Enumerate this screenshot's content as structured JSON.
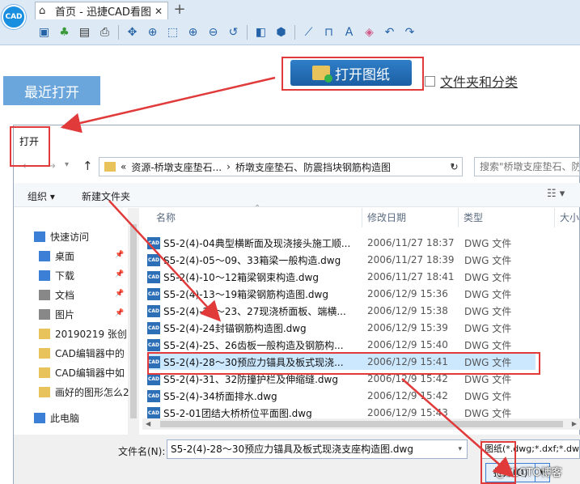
{
  "app": {
    "logo_text": "CAD",
    "tab_title": "首页 - 迅捷CAD看图",
    "tab_close": "✕",
    "new_tab": "+"
  },
  "toolbar": {
    "icons": [
      "add-file-icon",
      "palm-tree-icon",
      "save-icon",
      "print-icon",
      "pan-icon",
      "zoom-window-icon",
      "zoom-extents-icon",
      "zoom-in-icon",
      "zoom-out-icon",
      "zoom-previous-icon",
      "3d-box-icon",
      "3d-view-icon",
      "measure-line-icon",
      "measure-area-icon",
      "text-icon",
      "eraser-icon",
      "undo-icon",
      "redo-icon"
    ]
  },
  "home": {
    "recent_label": "最近打开",
    "open_button": "打开图纸",
    "folder_checkbox_label": "文件夹和分类"
  },
  "dialog": {
    "title": "打开",
    "address": {
      "prefix": "«",
      "crumb1": "资源-桥墩支座垫石...",
      "sep": "›",
      "crumb2": "桥墩支座垫石、防震挡块钢筋构造图"
    },
    "search_placeholder": "搜索\"桥墩支座垫石、防",
    "organize": "组织 ▾",
    "new_folder": "新建文件夹",
    "nav": [
      {
        "label": "快速访问",
        "icon": "star-icon"
      },
      {
        "label": "桌面",
        "icon": "desktop-icon"
      },
      {
        "label": "下载",
        "icon": "download-icon"
      },
      {
        "label": "文档",
        "icon": "document-icon"
      },
      {
        "label": "图片",
        "icon": "picture-icon"
      },
      {
        "label": "20190219  张创",
        "icon": "folder-icon"
      },
      {
        "label": "CAD编辑器中的",
        "icon": "folder-icon"
      },
      {
        "label": "CAD编辑器中如",
        "icon": "folder-icon"
      },
      {
        "label": "画好的图形怎么2",
        "icon": "folder-icon"
      },
      {
        "label": "此电脑",
        "icon": "computer-icon"
      }
    ],
    "columns": {
      "name": "名称",
      "date": "修改日期",
      "type": "类型",
      "size": "大小"
    },
    "files": [
      {
        "name": "S5-2(4)-04典型横断面及现浇接头施工顺...",
        "date": "2006/11/27 18:37",
        "type": "DWG 文件"
      },
      {
        "name": "S5-2(4)-05～09、33箱梁一般构造.dwg",
        "date": "2006/11/27 18:39",
        "type": "DWG 文件"
      },
      {
        "name": "S5-2(4)-10～12箱梁钢束构造.dwg",
        "date": "2006/11/27 18:41",
        "type": "DWG 文件"
      },
      {
        "name": "S5-2(4)-13～19箱梁钢筋构造图.dwg",
        "date": "2006/12/9 15:36",
        "type": "DWG 文件"
      },
      {
        "name": "S5-2(4)-20～23、27现浇桥面板、端横...",
        "date": "2006/12/9 15:38",
        "type": "DWG 文件"
      },
      {
        "name": "S5-2(4)-24封锚钢筋构造图.dwg",
        "date": "2006/12/9 15:39",
        "type": "DWG 文件"
      },
      {
        "name": "S5-2(4)-25、26齿板一般构造及钢筋构...",
        "date": "2006/12/9 15:40",
        "type": "DWG 文件"
      },
      {
        "name": "S5-2(4)-28～30预应力锚具及板式现浇...",
        "date": "2006/12/9 15:41",
        "type": "DWG 文件"
      },
      {
        "name": "S5-2(4)-31、32防撞护栏及伸缩缝.dwg",
        "date": "2006/12/9 15:42",
        "type": "DWG 文件"
      },
      {
        "name": "S5-2(4)-34桥面排水.dwg",
        "date": "2006/12/9 15:42",
        "type": "DWG 文件"
      },
      {
        "name": "S5-2-01团结大桥桥位平面图.dwg",
        "date": "2006/12/9 15:43",
        "type": "DWG 文件"
      }
    ],
    "file_icon_text": "CAD",
    "filename_label": "文件名(N):",
    "filename_value": "S5-2(4)-28～30预应力锚具及板式现浇支座构造图.dwg",
    "filter_value": "图纸(*.dwg;*.dxf;*.dwt)",
    "open_button": "打开(O)",
    "watermark": "@51CTO博客"
  },
  "colors": {
    "accent": "#1c5fa3",
    "highlight": "#e03a3a",
    "selected_row": "#cce8ff"
  }
}
